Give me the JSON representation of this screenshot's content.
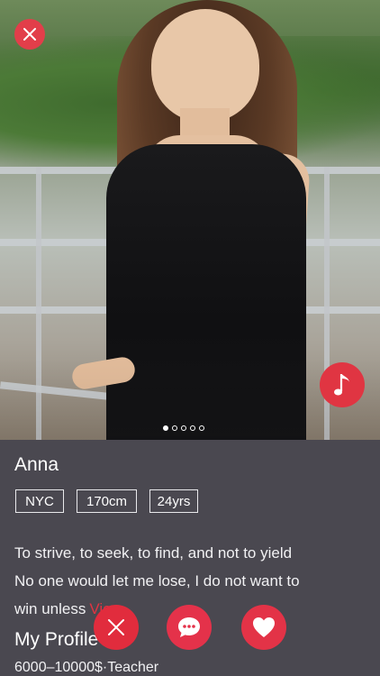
{
  "profile": {
    "name": "Anna",
    "tags": [
      "NYC",
      "170cm",
      "24yrs"
    ],
    "bio_line1": "To strive, to seek, to find, and not to yield",
    "bio_line2": "No one would let me lose, I do not want to",
    "bio_line3": "win unless",
    "bio_more": "View",
    "section_title": "My Profile",
    "profile_detail": "6000–10000$·Teacher"
  },
  "gallery": {
    "photo_count": 5,
    "active_index": 0
  },
  "colors": {
    "accent": "#e03542",
    "panel": "#4a4850",
    "text": "#ffffff"
  },
  "icons": {
    "close": "close-icon",
    "music": "music-note-icon",
    "pass": "x-icon",
    "chat": "chat-bubble-icon",
    "like": "heart-icon"
  }
}
